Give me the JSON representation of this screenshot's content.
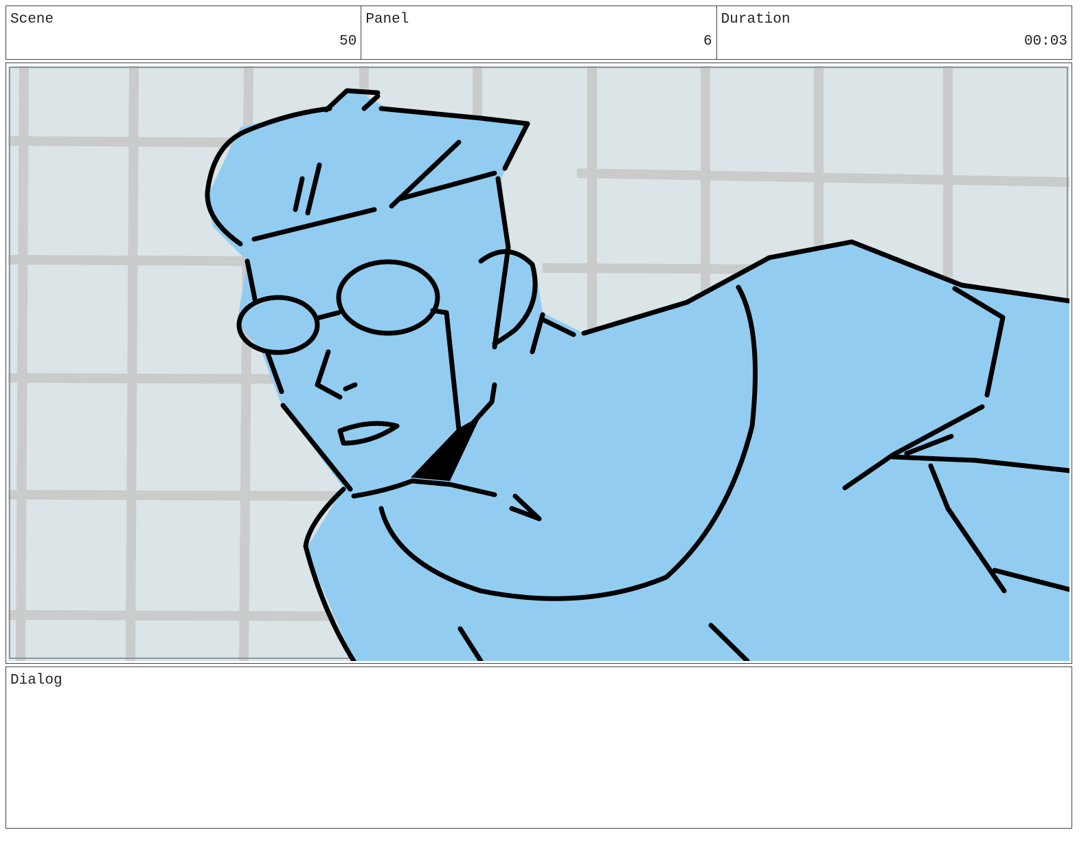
{
  "header": {
    "scene_label": "Scene",
    "scene_value": "50",
    "panel_label": "Panel",
    "panel_value": "6",
    "duration_label": "Duration",
    "duration_value": "00:03"
  },
  "dialog": {
    "label": "Dialog",
    "text": ""
  },
  "colors": {
    "figure_fill": "#92cdf1",
    "background": "#dbe4e6",
    "grid": "#c8c8c8",
    "ink": "#000000"
  }
}
